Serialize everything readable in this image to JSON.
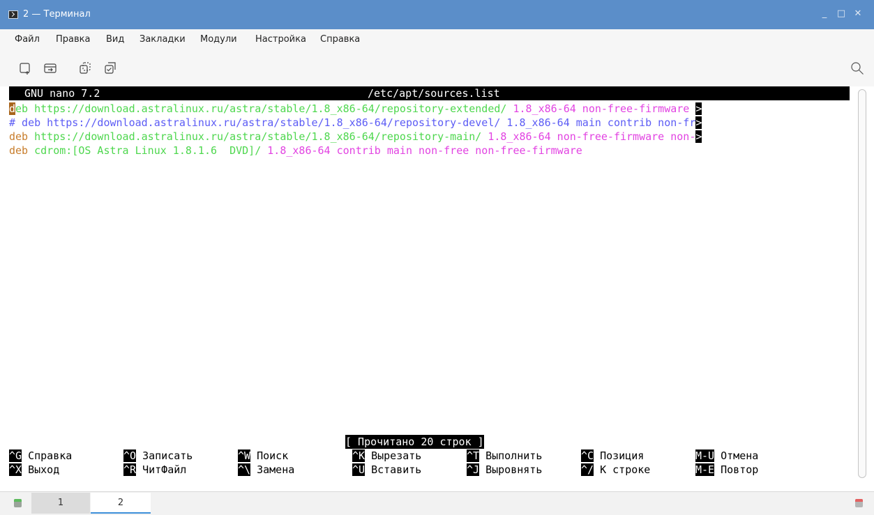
{
  "window": {
    "title": "2 — Терминал",
    "minimize_glyph": "_",
    "maximize_glyph": "□",
    "close_glyph": "✕"
  },
  "menu": [
    "Файл",
    "Правка",
    "Вид",
    "Закладки",
    "Модули",
    "Настройка",
    "Справка"
  ],
  "toolbar_icons": [
    "new-tab-icon",
    "split-view-icon",
    "copy-icon",
    "paste-icon",
    "search-icon"
  ],
  "nano": {
    "version": "GNU nano 7.2",
    "filename": "/etc/apt/sources.list",
    "lines": [
      {
        "a": "d",
        "b": "eb https://download.astralinux.ru/astra/stable/1.8_x86-64/repository-extended/ ",
        "c": "1.8_x86-64 non-free-firmware ",
        "d": ">"
      },
      {
        "a": "# deb https://download.astralinux.ru/astra/stable/1.8_x86-64/repository-devel/ 1.8_x86-64 main contrib non-fr",
        "d": ">"
      },
      {
        "a": "deb",
        "b": " https://download.astralinux.ru/astra/stable/1.8_x86-64/repository-main/ ",
        "c": "1.8_x86-64 non-free-firmware non-",
        "d": ">"
      },
      {
        "a": "deb",
        "b": " cdrom:[OS Astra Linux 1.8.1.6  DVD]/ ",
        "c": "1.8_x86-64 contrib main non-free non-free-firmware"
      }
    ],
    "status": "[ Прочитано 20 строк ]",
    "shortcuts_row1": [
      {
        "key": "^G",
        "label": "Справка"
      },
      {
        "key": "^O",
        "label": "Записать"
      },
      {
        "key": "^W",
        "label": "Поиск"
      },
      {
        "key": "^K",
        "label": "Вырезать"
      },
      {
        "key": "^T",
        "label": "Выполнить"
      },
      {
        "key": "^C",
        "label": "Позиция"
      },
      {
        "key": "M-U",
        "label": "Отмена"
      }
    ],
    "shortcuts_row2": [
      {
        "key": "^X",
        "label": "Выход"
      },
      {
        "key": "^R",
        "label": "ЧитФайл"
      },
      {
        "key": "^\\",
        "label": "Замена"
      },
      {
        "key": "^U",
        "label": "Вставить"
      },
      {
        "key": "^J",
        "label": "Выровнять"
      },
      {
        "key": "^/",
        "label": "К строке"
      },
      {
        "key": "M-E",
        "label": "Повтор"
      }
    ]
  },
  "tabs": [
    {
      "label": "1",
      "active": false
    },
    {
      "label": "2",
      "active": true
    }
  ],
  "colors": {
    "titlebar": "#5b8ec9",
    "url_green": "#4ed74e",
    "suite_magenta": "#e243e2",
    "comment_blue": "#5c5cf5",
    "deb_orange": "#c87d2c",
    "active_tab_underline": "#3d8fd9"
  }
}
